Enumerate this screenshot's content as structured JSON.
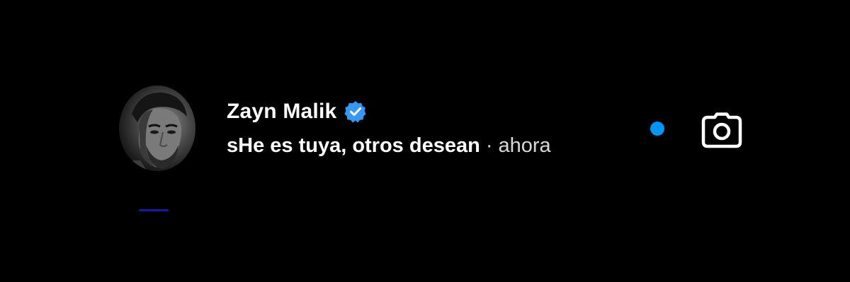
{
  "thread": {
    "name": "Zayn Malik",
    "preview": "sHe es tuya, otros desean",
    "separator": "·",
    "time": "ahora",
    "verified": true,
    "unread": true
  },
  "icons": {
    "avatar": "profile-photo",
    "verified": "verified-badge-icon",
    "unread": "unread-dot",
    "camera": "camera-icon"
  },
  "colors": {
    "background": "#000000",
    "accent": "#0095f6",
    "verified_badge": "#3897f0",
    "text_primary": "#ffffff",
    "text_secondary": "#d8d8d8",
    "bottom_accent": "#1a1aa6"
  }
}
